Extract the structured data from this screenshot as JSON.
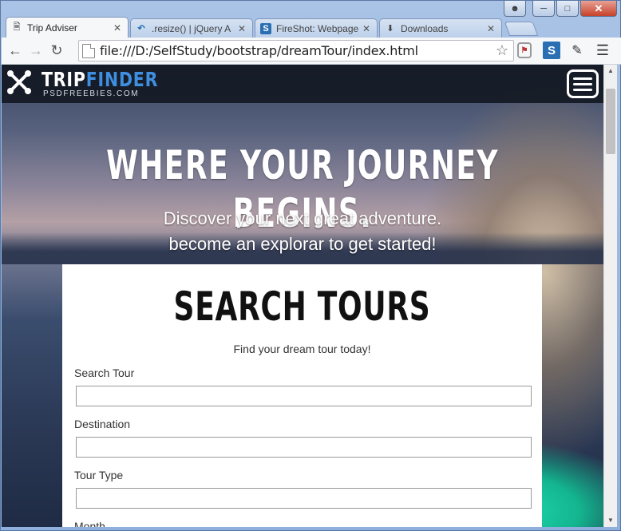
{
  "browser": {
    "tabs": [
      {
        "label": "Trip Adviser",
        "icon": "page-icon",
        "active": true
      },
      {
        "label": ".resize() | jQuery A",
        "icon": "jquery-icon",
        "active": false
      },
      {
        "label": "FireShot: Webpage",
        "icon": "fireshot-icon",
        "active": false
      },
      {
        "label": "Downloads",
        "icon": "download-icon",
        "active": false
      }
    ],
    "url": "file:///D:/SelfStudy/bootstrap/dreamTour/index.html"
  },
  "site": {
    "logo_part1": "TRIP",
    "logo_part2": "FINDER",
    "logo_sub": "PSDFREEBIES.COM",
    "brand_color": "#3f8fe0"
  },
  "hero": {
    "title": "WHERE YOUR JOURNEY BEGINS.",
    "subtitle_line1": "Discover your next great adventure.",
    "subtitle_line2": "become an explorar to get started!"
  },
  "search": {
    "title": "SEARCH TOURS",
    "tagline": "Find your dream tour today!",
    "fields": [
      {
        "label": "Search Tour",
        "value": ""
      },
      {
        "label": "Destination",
        "value": ""
      },
      {
        "label": "Tour Type",
        "value": ""
      },
      {
        "label": "Month",
        "value": ""
      }
    ]
  }
}
